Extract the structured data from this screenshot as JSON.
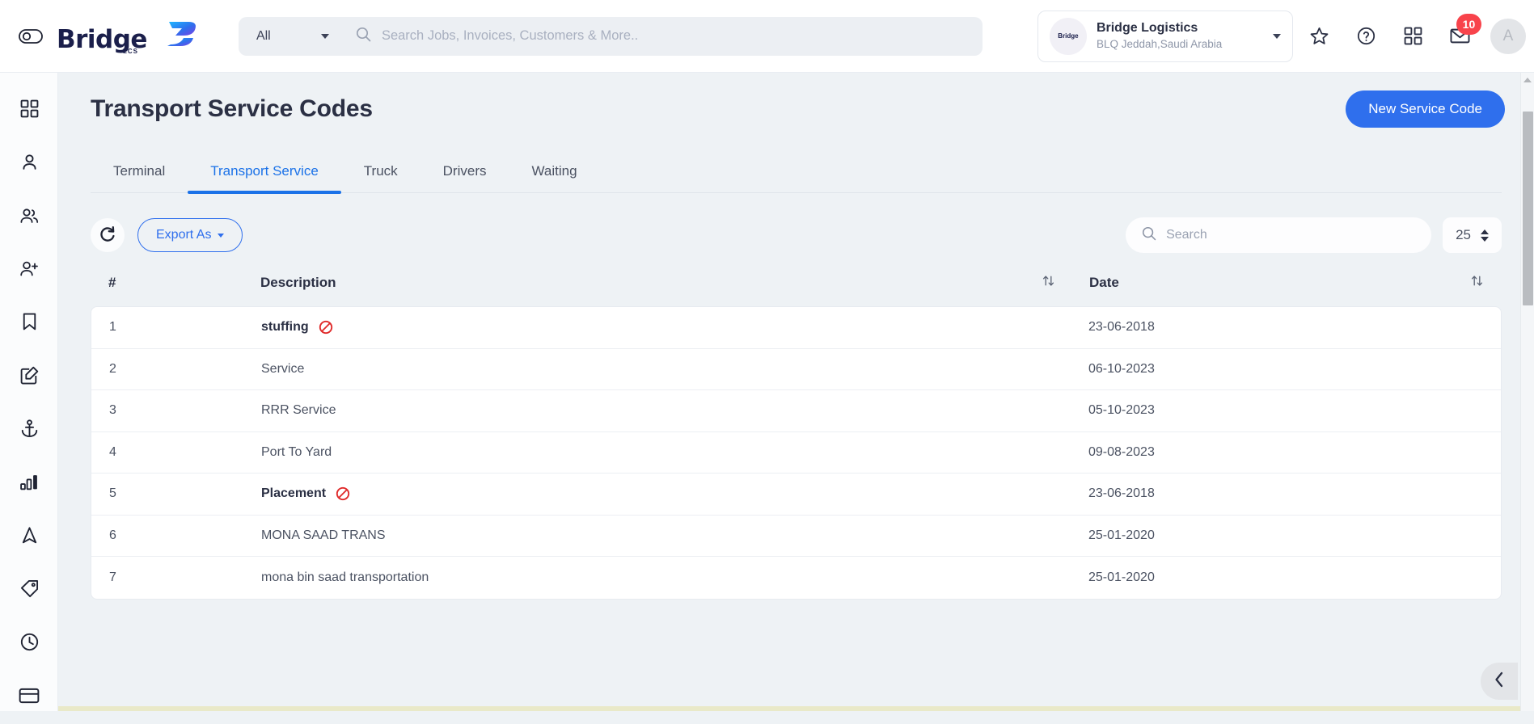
{
  "topbar": {
    "toggle_icon": "eye-toggle-icon",
    "brand_word": "Bridge",
    "brand_sub": "LCS",
    "scope_label": "All",
    "search_placeholder": "Search Jobs, Invoices, Customers & More..",
    "search_value": "",
    "org": {
      "avatar_word": "Bridge",
      "name": "Bridge Logistics",
      "location": "BLQ Jeddah,Saudi Arabia"
    },
    "icons": [
      {
        "name": "star-icon"
      },
      {
        "name": "help-circle-icon"
      },
      {
        "name": "apps-grid-icon"
      },
      {
        "name": "mail-icon",
        "badge": "10"
      }
    ],
    "avatar_initial": "A",
    "badge_color": "#f8434b"
  },
  "sidebar": {
    "items": [
      {
        "name": "sidebar-item-dashboard",
        "icon": "grid-icon"
      },
      {
        "name": "sidebar-item-user",
        "icon": "user-icon"
      },
      {
        "name": "sidebar-item-users",
        "icon": "users-icon"
      },
      {
        "name": "sidebar-item-add-user",
        "icon": "user-plus-icon"
      },
      {
        "name": "sidebar-item-bookmarks",
        "icon": "bookmark-icon"
      },
      {
        "name": "sidebar-item-edit",
        "icon": "edit-square-icon"
      },
      {
        "name": "sidebar-item-port",
        "icon": "anchor-icon"
      },
      {
        "name": "sidebar-item-reports",
        "icon": "bar-chart-icon"
      },
      {
        "name": "sidebar-item-navigation",
        "icon": "navigation-icon"
      },
      {
        "name": "sidebar-item-tags",
        "icon": "tag-icon"
      },
      {
        "name": "sidebar-item-history",
        "icon": "clock-icon"
      },
      {
        "name": "sidebar-item-billing",
        "icon": "credit-card-icon"
      }
    ]
  },
  "page": {
    "title": "Transport Service Codes",
    "new_button": "New Service Code",
    "primary_color": "#2f6fed"
  },
  "tabs": [
    {
      "label": "Terminal",
      "active": false
    },
    {
      "label": "Transport Service",
      "active": true
    },
    {
      "label": "Truck",
      "active": false
    },
    {
      "label": "Drivers",
      "active": false
    },
    {
      "label": "Waiting",
      "active": false
    }
  ],
  "toolbar": {
    "refresh_icon": "refresh-icon",
    "export_label": "Export As",
    "search_placeholder": "Search",
    "search_value": "",
    "page_size": "25"
  },
  "table": {
    "columns": [
      "#",
      "Description",
      "Date"
    ],
    "rows": [
      {
        "num": "1",
        "description": "stuffing",
        "date": "23-06-2018",
        "bold": true,
        "blocked": true
      },
      {
        "num": "2",
        "description": "Service",
        "date": "06-10-2023",
        "bold": false,
        "blocked": false
      },
      {
        "num": "3",
        "description": "RRR Service",
        "date": "05-10-2023",
        "bold": false,
        "blocked": false
      },
      {
        "num": "4",
        "description": "Port To Yard",
        "date": "09-08-2023",
        "bold": false,
        "blocked": false
      },
      {
        "num": "5",
        "description": "Placement",
        "date": "23-06-2018",
        "bold": true,
        "blocked": true
      },
      {
        "num": "6",
        "description": "MONA SAAD TRANS",
        "date": "25-01-2020",
        "bold": false,
        "blocked": false
      },
      {
        "num": "7",
        "description": "mona bin saad transportation",
        "date": "25-01-2020",
        "bold": false,
        "blocked": false
      }
    ],
    "blocked_icon": "no-entry-icon",
    "blocked_color": "#e02b2b",
    "sort_icon": "sort-updown-icon"
  },
  "chrome": {
    "collapse_icon": "chevron-left-icon"
  }
}
